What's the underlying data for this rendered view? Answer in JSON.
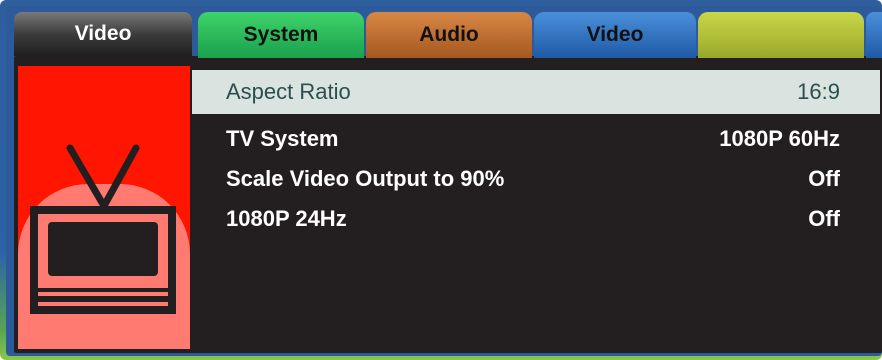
{
  "colors": {
    "frame": "#2d5a9b",
    "content_bg": "#231f20",
    "side_panel": "#ff1500",
    "selected_row": "#d9e3df",
    "tab_system": "#1aa14c",
    "tab_audio": "#a5581f",
    "tab_video": "#1f5aa5",
    "tab_blank": "#9aa82a"
  },
  "side": {
    "title": "Video",
    "icon": "tv-icon"
  },
  "tabs": [
    {
      "label": "System"
    },
    {
      "label": "Audio"
    },
    {
      "label": "Video"
    },
    {
      "label": ""
    }
  ],
  "menu": {
    "items": [
      {
        "label": "Aspect Ratio",
        "value": "16:9"
      },
      {
        "label": "TV System",
        "value": "1080P 60Hz"
      },
      {
        "label": "Scale Video Output to 90%",
        "value": "Off"
      },
      {
        "label": "1080P 24Hz",
        "value": "Off"
      }
    ]
  }
}
